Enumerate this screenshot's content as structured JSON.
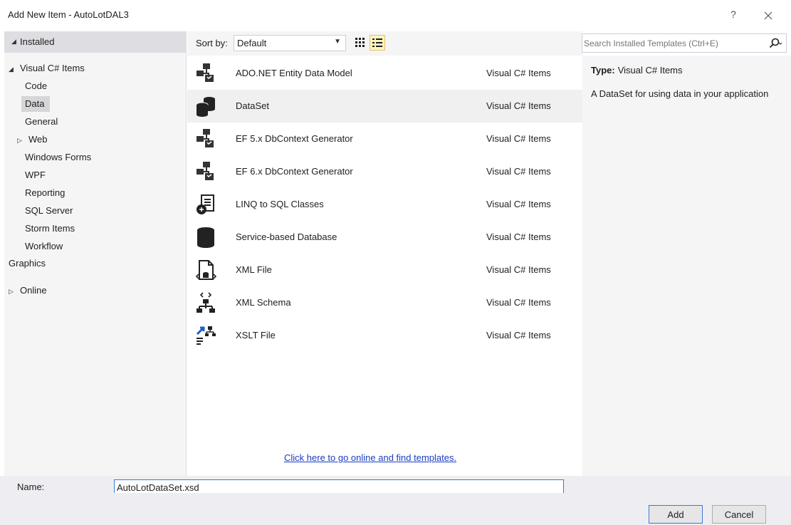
{
  "window": {
    "title": "Add New Item - AutoLotDAL3",
    "help_label": "?",
    "close_icon": "close-icon"
  },
  "left_panel": {
    "installed_label": "Installed",
    "tree": [
      {
        "label": "Visual C# Items",
        "expanded": true
      },
      {
        "label": "Code"
      },
      {
        "label": "Data",
        "selected": true
      },
      {
        "label": "General"
      },
      {
        "label": "Web",
        "collapsed": true
      },
      {
        "label": "Windows Forms"
      },
      {
        "label": "WPF"
      },
      {
        "label": "Reporting"
      },
      {
        "label": "SQL Server"
      },
      {
        "label": "Storm Items"
      },
      {
        "label": "Workflow"
      },
      {
        "label": "Graphics"
      }
    ],
    "online_label": "Online"
  },
  "toolbar": {
    "sort_label": "Sort by:",
    "sort_value": "Default",
    "view_icons": [
      "small-icons-view-icon",
      "list-view-icon"
    ]
  },
  "search": {
    "placeholder": "Search Installed Templates (Ctrl+E)"
  },
  "templates": [
    {
      "name": "ADO.NET Entity Data Model",
      "category": "Visual C# Items",
      "icon": "entity-model-icon"
    },
    {
      "name": "DataSet",
      "category": "Visual C# Items",
      "icon": "dataset-icon",
      "selected": true
    },
    {
      "name": "EF 5.x DbContext Generator",
      "category": "Visual C# Items",
      "icon": "entity-model-icon"
    },
    {
      "name": "EF 6.x DbContext Generator",
      "category": "Visual C# Items",
      "icon": "entity-model-icon"
    },
    {
      "name": "LINQ to SQL Classes",
      "category": "Visual C# Items",
      "icon": "linq-classes-icon"
    },
    {
      "name": "Service-based Database",
      "category": "Visual C# Items",
      "icon": "database-icon"
    },
    {
      "name": "XML File",
      "category": "Visual C# Items",
      "icon": "xml-file-icon"
    },
    {
      "name": "XML Schema",
      "category": "Visual C# Items",
      "icon": "xml-schema-icon"
    },
    {
      "name": "XSLT File",
      "category": "Visual C# Items",
      "icon": "xslt-file-icon"
    }
  ],
  "online_link": "Click here to go online and find templates.",
  "details": {
    "type_key": "Type:",
    "type_value": "Visual C# Items",
    "description": "A DataSet for using data in your application"
  },
  "name_field": {
    "label": "Name:",
    "value": "AutoLotDataSet.xsd"
  },
  "buttons": {
    "add": "Add",
    "cancel": "Cancel"
  }
}
